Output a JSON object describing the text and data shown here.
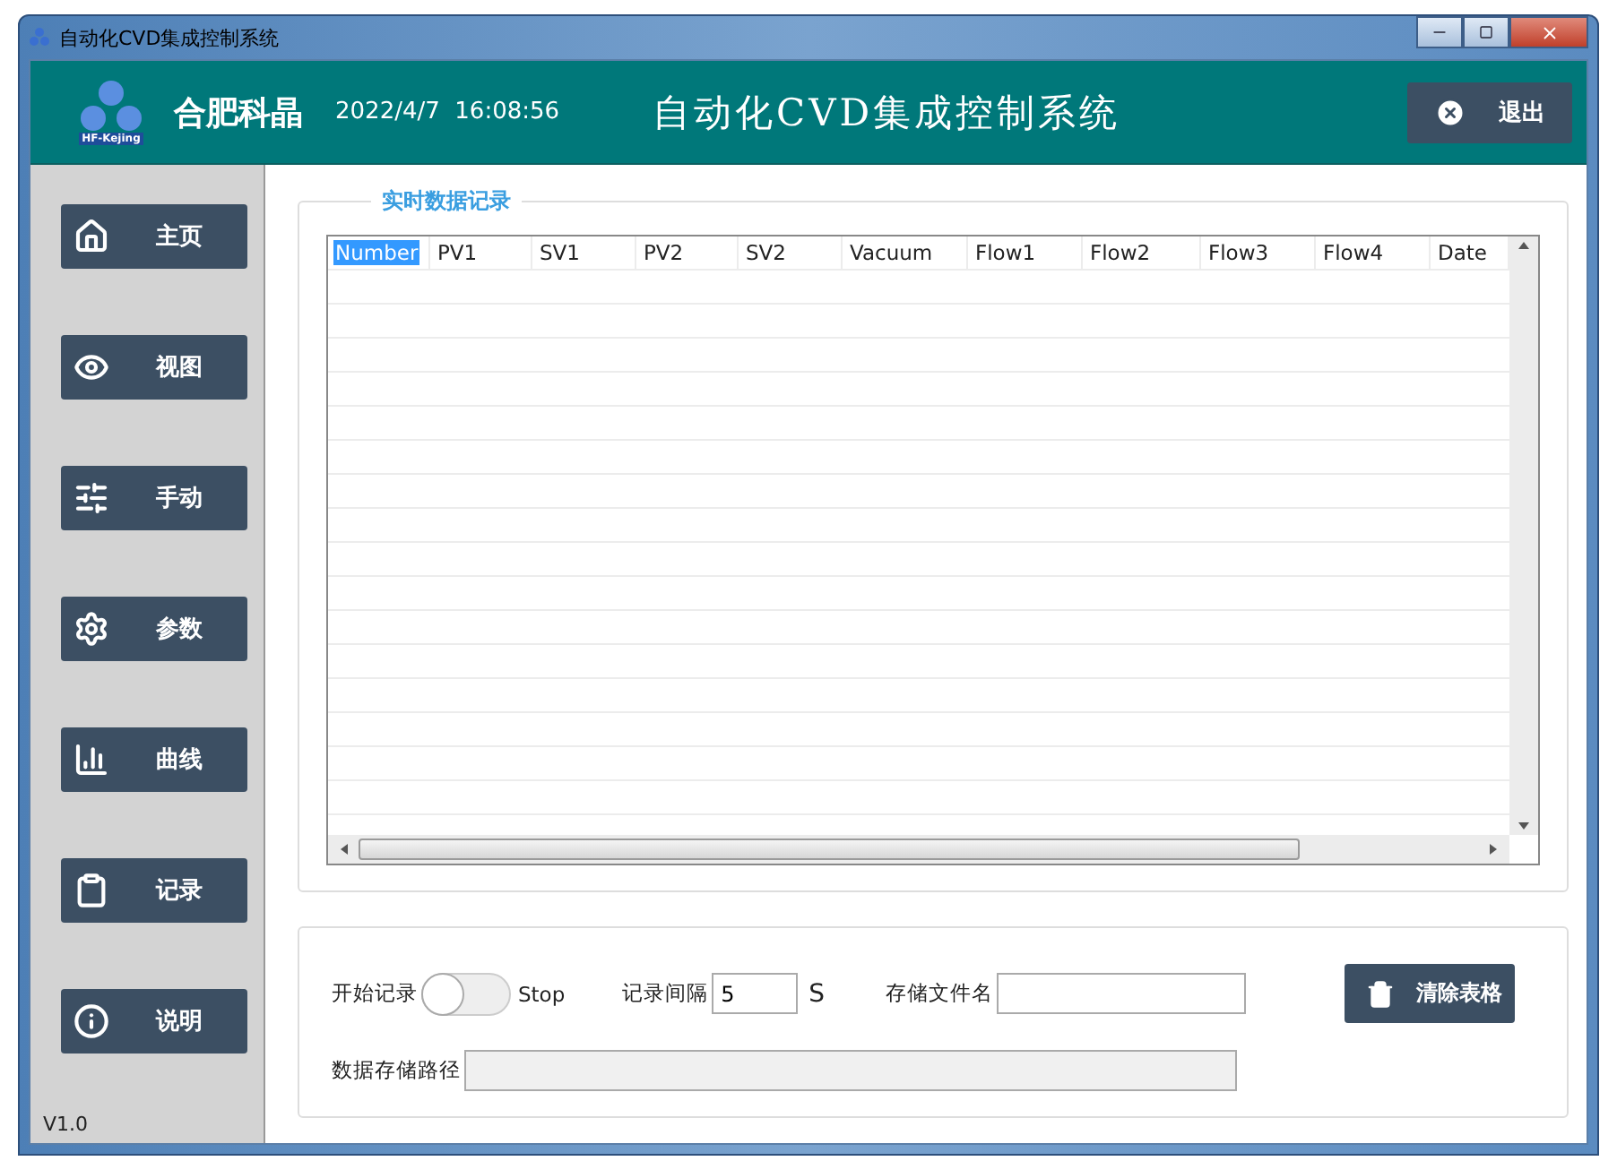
{
  "window": {
    "title": "自动化CVD集成控制系统"
  },
  "header": {
    "company": "合肥科晶",
    "logo_text": "HF-Kejing",
    "datetime": "2022/4/7  16:08:56",
    "title": "自动化CVD集成控制系统",
    "exit_button": "退出"
  },
  "sidebar": {
    "items": [
      {
        "label": "主页"
      },
      {
        "label": "视图"
      },
      {
        "label": "手动"
      },
      {
        "label": "参数"
      },
      {
        "label": "曲线"
      },
      {
        "label": "记录"
      },
      {
        "label": "说明"
      }
    ],
    "version": "V1.0"
  },
  "record_panel": {
    "title": "实时数据记录",
    "table": {
      "columns": [
        {
          "label": "Number",
          "selected": true
        },
        {
          "label": "PV1",
          "selected": false
        },
        {
          "label": "SV1",
          "selected": false
        },
        {
          "label": "PV2",
          "selected": false
        },
        {
          "label": "SV2",
          "selected": false
        },
        {
          "label": "Vacuum",
          "selected": false
        },
        {
          "label": "Flow1",
          "selected": false
        },
        {
          "label": "Flow2",
          "selected": false
        },
        {
          "label": "Flow3",
          "selected": false
        },
        {
          "label": "Flow4",
          "selected": false
        },
        {
          "label": "Date",
          "selected": false
        }
      ]
    }
  },
  "controls": {
    "record_toggle": {
      "label": "开始记录",
      "on": false,
      "state_text": "Stop"
    },
    "interval": {
      "label": "记录间隔",
      "value": "5",
      "unit": "S"
    },
    "file_name": {
      "label": "存储文件名"
    },
    "clear_button": "清除表格",
    "path": {
      "label": "数据存储路径"
    }
  }
}
